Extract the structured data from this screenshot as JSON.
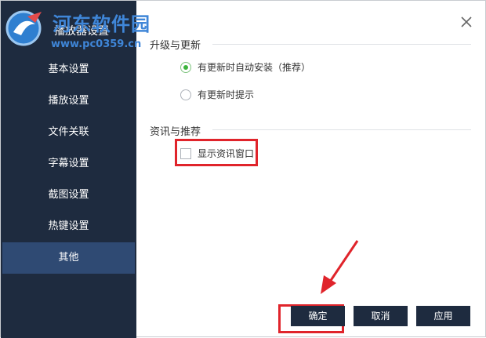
{
  "watermark": {
    "text": "河东软件园",
    "url": "www.pc0359.cn"
  },
  "window": {
    "title": "播放器设置"
  },
  "sidebar": {
    "items": [
      {
        "label": "基本设置",
        "active": false
      },
      {
        "label": "播放设置",
        "active": false
      },
      {
        "label": "文件关联",
        "active": false
      },
      {
        "label": "字幕设置",
        "active": false
      },
      {
        "label": "截图设置",
        "active": false
      },
      {
        "label": "热键设置",
        "active": false
      },
      {
        "label": "其他",
        "active": true
      }
    ]
  },
  "sections": {
    "update": {
      "title": "升级与更新",
      "options": [
        {
          "label": "有更新时自动安装（推荐）",
          "selected": true
        },
        {
          "label": "有更新时提示",
          "selected": false
        }
      ]
    },
    "news": {
      "title": "资讯与推荐",
      "checkbox": {
        "label": "显示资讯窗口",
        "checked": false
      }
    }
  },
  "buttons": {
    "ok": "确定",
    "cancel": "取消",
    "apply": "应用"
  },
  "icons": {
    "close": "close-icon",
    "logo": "watermark-logo-icon",
    "arrow": "annotation-arrow-icon"
  },
  "colors": {
    "sidebar_bg": "#1e2b3f",
    "active_item": "#2f4a73",
    "highlight": "#e0242b",
    "radio_selected": "#3cb43c"
  }
}
